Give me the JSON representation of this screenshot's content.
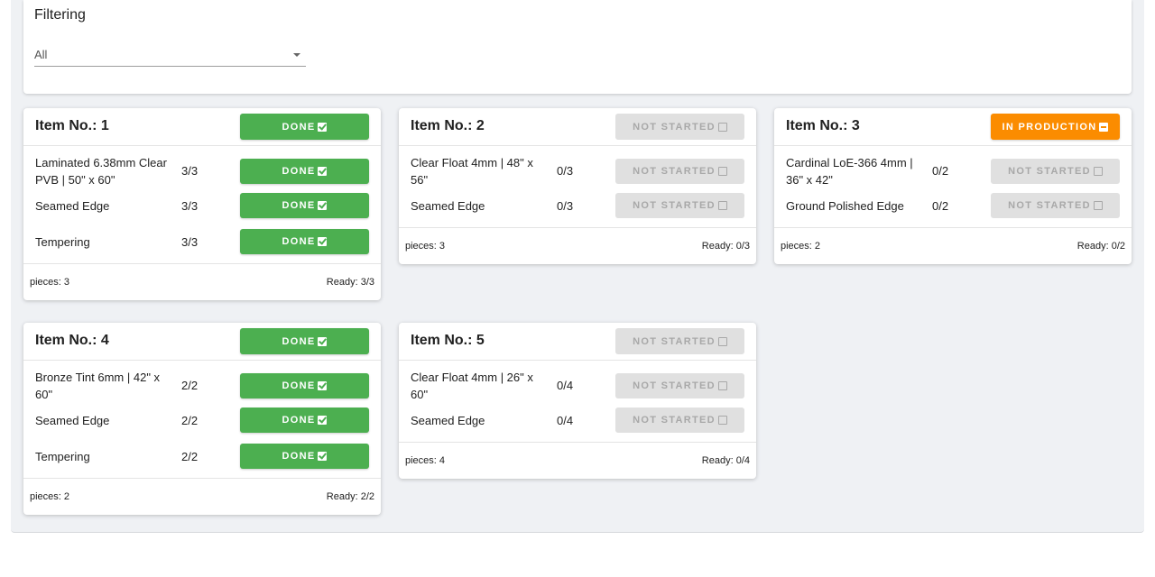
{
  "filter": {
    "title": "Filtering",
    "selected": "All"
  },
  "cards": [
    {
      "title": "Item No.: 1",
      "status": "DONE",
      "rows": [
        {
          "label": "Laminated 6.38mm Clear PVB | 50\" x 60\"",
          "count": "3/3",
          "status": "DONE"
        },
        {
          "label": "Seamed Edge",
          "count": "3/3",
          "status": "DONE"
        },
        {
          "label": "Tempering",
          "count": "3/3",
          "status": "DONE"
        }
      ],
      "pieces": "pieces: 3",
      "ready": "Ready: 3/3"
    },
    {
      "title": "Item No.: 2",
      "status": "NOT STARTED",
      "rows": [
        {
          "label": "Clear Float 4mm | 48\" x 56\"",
          "count": "0/3",
          "status": "NOT STARTED"
        },
        {
          "label": "Seamed Edge",
          "count": "0/3",
          "status": "NOT STARTED"
        }
      ],
      "pieces": "pieces: 3",
      "ready": "Ready: 0/3"
    },
    {
      "title": "Item No.: 3",
      "status": "IN PRODUCTION",
      "rows": [
        {
          "label": "Cardinal LoE-366 4mm | 36\" x 42\"",
          "count": "0/2",
          "status": "NOT STARTED"
        },
        {
          "label": "Ground Polished Edge",
          "count": "0/2",
          "status": "NOT STARTED"
        }
      ],
      "pieces": "pieces: 2",
      "ready": "Ready: 0/2"
    },
    {
      "title": "Item No.: 4",
      "status": "DONE",
      "rows": [
        {
          "label": "Bronze Tint 6mm | 42\" x 60\"",
          "count": "2/2",
          "status": "DONE"
        },
        {
          "label": "Seamed Edge",
          "count": "2/2",
          "status": "DONE"
        },
        {
          "label": "Tempering",
          "count": "2/2",
          "status": "DONE"
        }
      ],
      "pieces": "pieces: 2",
      "ready": "Ready: 2/2"
    },
    {
      "title": "Item No.: 5",
      "status": "NOT STARTED",
      "rows": [
        {
          "label": "Clear Float 4mm | 26\" x 60\"",
          "count": "0/4",
          "status": "NOT STARTED"
        },
        {
          "label": "Seamed Edge",
          "count": "0/4",
          "status": "NOT STARTED"
        }
      ],
      "pieces": "pieces: 4",
      "ready": "Ready: 0/4"
    }
  ],
  "colors": {
    "done": "#4caf50",
    "not_started": "#e0e0e0",
    "in_production": "#fb8c00"
  }
}
